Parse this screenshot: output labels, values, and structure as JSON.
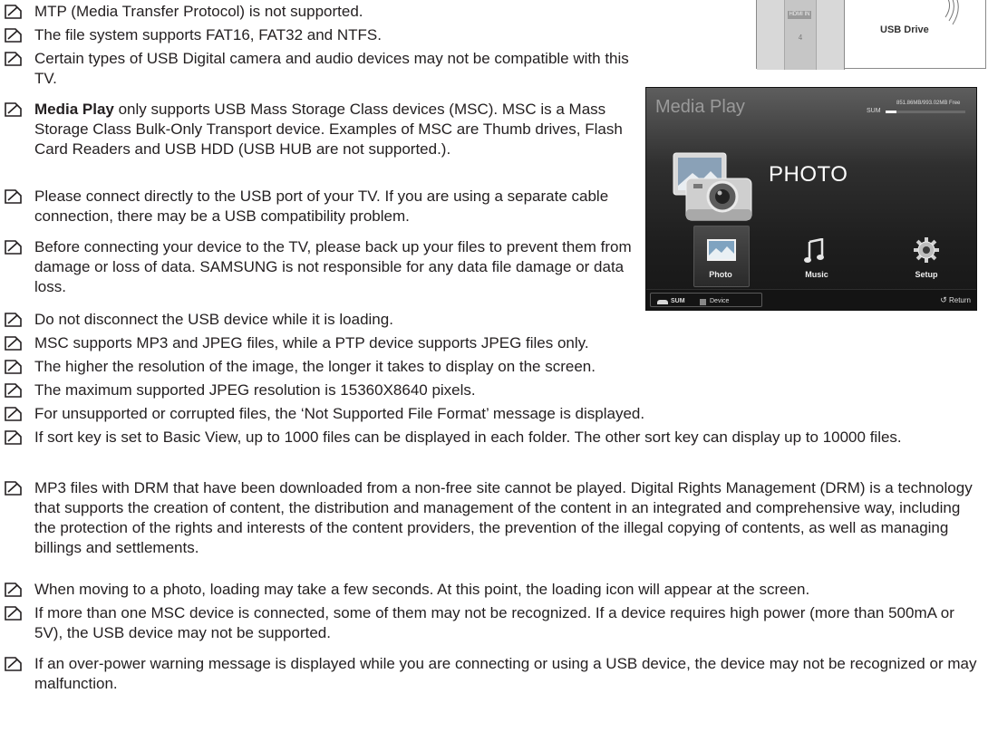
{
  "icon": "note-icon",
  "notes": [
    {
      "text": "MTP (Media Transfer Protocol) is not supported."
    },
    {
      "text": "The file system supports FAT16, FAT32 and NTFS."
    },
    {
      "text": "Certain types of USB Digital camera and audio devices may not be compatible with this TV."
    },
    {
      "bold": "Media Play",
      "text": " only supports USB Mass Storage Class devices (MSC). MSC is a Mass Storage Class Bulk-Only Transport device. Examples of MSC are Thumb drives, Flash Card Readers and USB HDD (USB HUB are not supported.)."
    },
    {
      "text": "Please connect directly to the USB port of your TV. If you are using a separate cable connection, there may be a USB compatibility problem."
    },
    {
      "text": "Before connecting your device to the TV, please back up your files to prevent them from damage or loss of data. SAMSUNG is not responsible for any data file damage or data loss."
    },
    {
      "text": "Do not disconnect the USB device while it is loading."
    },
    {
      "text": "MSC supports MP3 and JPEG files, while a PTP device supports JPEG files only."
    },
    {
      "text": "The higher the resolution of the image, the longer it takes to display on the screen."
    },
    {
      "text": "The maximum supported JPEG resolution is 15360X8640 pixels."
    },
    {
      "text": "For unsupported or corrupted files, the ‘Not Supported File Format’ message is displayed."
    },
    {
      "text": "If sort key is set to Basic View, up to 1000 files can be displayed in each folder. The other sort key can display up to 10000 files."
    },
    {
      "text": "MP3 files with DRM that have been downloaded from a non-free site cannot be played. Digital Rights Management (DRM) is a technology that supports the creation of content, the distribution and management of the content in an integrated and comprehensive way, including the protection of the rights and interests of the content providers, the prevention of the illegal copying of contents, as well as managing billings and settlements."
    },
    {
      "text": "When moving to a photo, loading may take a few seconds. At this point, the loading icon will appear at the screen."
    },
    {
      "text": "If more than one MSC device is connected, some of them may not be recognized. If a device requires high power (more than 500mA or 5V), the USB device may not be supported."
    },
    {
      "text": "If an over-power warning message is displayed while you are connecting or using a USB device, the device may not be recognized or may malfunction."
    }
  ],
  "diagram": {
    "port_tag": "HDMI IN",
    "port_number": "4",
    "usb_drive_label": "USB Drive"
  },
  "media_play": {
    "title": "Media Play",
    "sum_label": "SUM",
    "storage": "851.86MB/993.02MB Free",
    "storage_used_fraction": 0.14,
    "current_mode": "PHOTO",
    "tabs": [
      {
        "label": "Photo",
        "icon": "photo-icon",
        "selected": true
      },
      {
        "label": "Music",
        "icon": "music-icon",
        "selected": false
      },
      {
        "label": "Setup",
        "icon": "gear-icon",
        "selected": false
      }
    ],
    "footer": {
      "sum": "SUM",
      "device": "Device",
      "return": "Return",
      "return_icon": "↺"
    }
  }
}
